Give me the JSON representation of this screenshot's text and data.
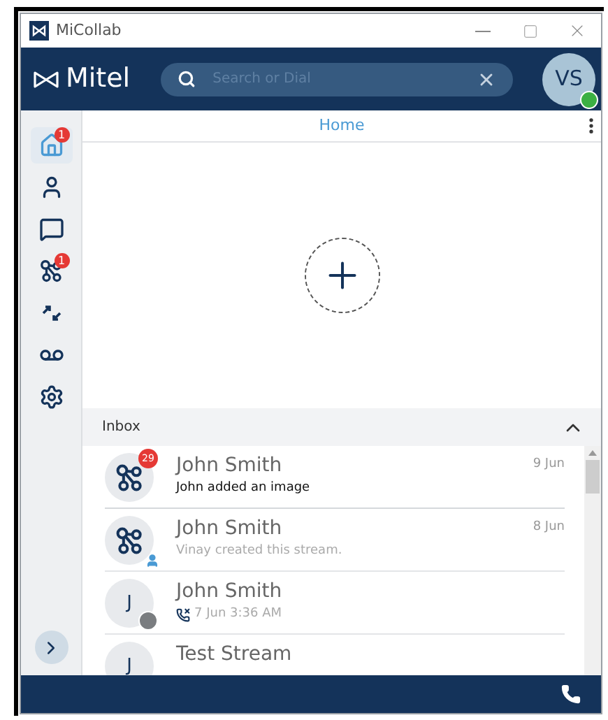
{
  "window": {
    "title": "MiCollab"
  },
  "header": {
    "brand": "Mitel",
    "search": {
      "placeholder": "Search or Dial"
    },
    "avatar": {
      "initials": "VS",
      "online": true
    }
  },
  "sidebar": {
    "items": [
      {
        "kind": "home",
        "selected": true,
        "badge": "1"
      },
      {
        "kind": "contacts",
        "selected": false
      },
      {
        "kind": "chat",
        "selected": false
      },
      {
        "kind": "streams",
        "selected": false,
        "badge": "1"
      },
      {
        "kind": "calls",
        "selected": false
      },
      {
        "kind": "voicemail",
        "selected": false
      },
      {
        "kind": "settings",
        "selected": false
      }
    ]
  },
  "page_title": "Home",
  "inbox": {
    "title": "Inbox",
    "expanded": true,
    "rows": [
      {
        "kind": "stream",
        "name": "John Smith",
        "date": "9 Jun",
        "subtitle": "John added an image",
        "unread": true,
        "owner": false,
        "badge": "29"
      },
      {
        "kind": "stream",
        "name": "John Smith",
        "date": "8 Jun",
        "subtitle": "Vinay created this stream.",
        "unread": false,
        "owner": true
      },
      {
        "kind": "call",
        "initial": "J",
        "name": "John Smith",
        "subtitle": "7 Jun 3:36 AM",
        "unread": false,
        "owner": false,
        "color": "#7a7d80"
      },
      {
        "kind": "contact",
        "initial": "J",
        "name": "Test Stream",
        "owner": false
      }
    ]
  }
}
